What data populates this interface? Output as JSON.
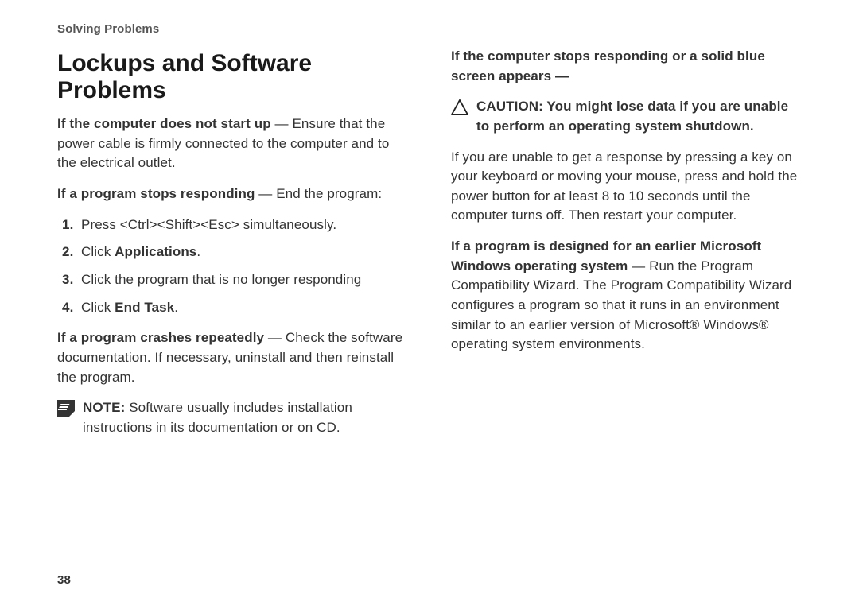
{
  "sectionHeader": "Solving Problems",
  "title": "Lockups and Software Problems",
  "left": {
    "p1_bold": "If the computer does not start up",
    "p1_rest": " — Ensure that the power cable is firmly connected to the computer and to the electrical outlet.",
    "p2_bold": "If a program stops responding",
    "p2_rest": " — End the program:",
    "steps": {
      "s1": "Press <Ctrl><Shift><Esc> simultaneously.",
      "s2a": "Click ",
      "s2b": "Applications",
      "s2c": ".",
      "s3": "Click the program that is no longer responding",
      "s4a": "Click ",
      "s4b": "End Task",
      "s4c": "."
    },
    "p3_bold": "If a program crashes repeatedly",
    "p3_rest": " — Check the software documentation. If necessary, uninstall and then reinstall the program.",
    "note_bold": "NOTE:",
    "note_rest": " Software usually includes installation instructions in its documentation or on CD."
  },
  "right": {
    "h1": "If the computer stops responding or a solid blue screen appears —",
    "caution": "CAUTION: You might lose data if you are unable to perform an operating system shutdown.",
    "p1": "If you are unable to get a response by pressing a key on your keyboard or moving your mouse, press and hold the power button for at least 8 to 10 seconds until the computer turns off. Then restart your computer.",
    "p2_bold": "If a program is designed for an earlier Microsoft Windows operating system",
    "p2_rest": " — Run the Program Compatibility Wizard. The Program Compatibility Wizard configures a program so that it runs in an environment similar to an earlier version of Microsoft® Windows® operating system environments."
  },
  "pageNumber": "38"
}
